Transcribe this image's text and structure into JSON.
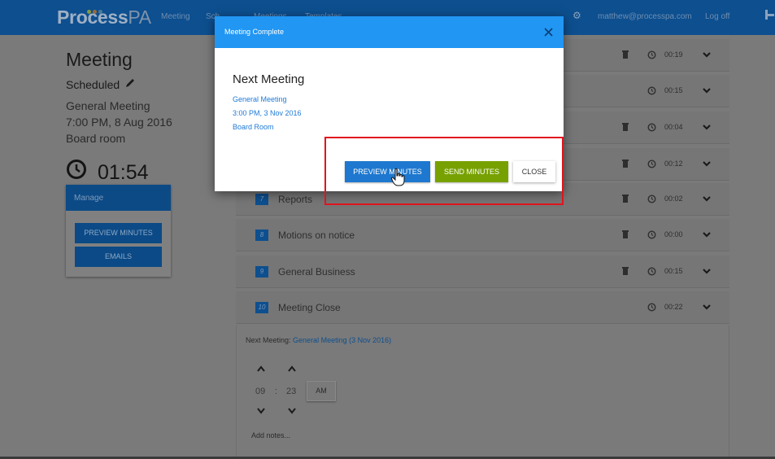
{
  "header": {
    "logo_main": "Process",
    "logo_suffix": "PA",
    "nav_items": [
      "Meeting",
      "Sch",
      "Meetings",
      "Templates"
    ],
    "user_email": "matthew@processpa.com",
    "logout": "Log off"
  },
  "sidebar": {
    "title": "Meeting",
    "status": "Scheduled",
    "meeting_name": "General Meeting",
    "meeting_datetime": "7:00 PM, 8 Aug 2016",
    "meeting_location": "Board room",
    "timer": "01:54",
    "manage_label": "Manage",
    "preview_minutes_label": "PREVIEW MINUTES",
    "emails_label": "EMAILS"
  },
  "agenda": {
    "rows": [
      {
        "number": "",
        "label": "",
        "time": "00:19",
        "trash": true
      },
      {
        "number": "",
        "label": "",
        "time": "00:15",
        "trash": false
      },
      {
        "number": "",
        "label": "",
        "time": "00:04",
        "trash": true
      },
      {
        "number": "",
        "label": "",
        "time": "00:12",
        "trash": true
      },
      {
        "number": "7",
        "label": "Reports",
        "time": "00:02",
        "trash": true
      },
      {
        "number": "8",
        "label": "Motions on notice",
        "time": "00:00",
        "trash": true
      },
      {
        "number": "9",
        "label": "General Business",
        "time": "00:15",
        "trash": true
      },
      {
        "number": "10",
        "label": "Meeting Close",
        "time": "00:22",
        "trash": false
      }
    ],
    "expanded": {
      "next_meeting_label": "Next Meeting:",
      "next_meeting_link": "General Meeting (3 Nov 2016)",
      "hour": "09",
      "separator": ":",
      "minute": "23",
      "ampm": "AM",
      "add_notes": "Add notes..."
    }
  },
  "modal": {
    "title": "Meeting Complete",
    "heading": "Next Meeting",
    "meeting_name": "General Meeting",
    "meeting_datetime": "3:00 PM, 3 Nov 2016",
    "meeting_location": "Board Room",
    "preview_label": "PREVIEW MINUTES",
    "send_label": "SEND MINUTES",
    "close_label": "CLOSE"
  },
  "colors": {
    "header_blue": "#2196f3",
    "primary_button": "#1e78cf",
    "send_button": "#77a100",
    "highlight_red": "#e0141e",
    "link_blue": "#1d7ad6"
  }
}
